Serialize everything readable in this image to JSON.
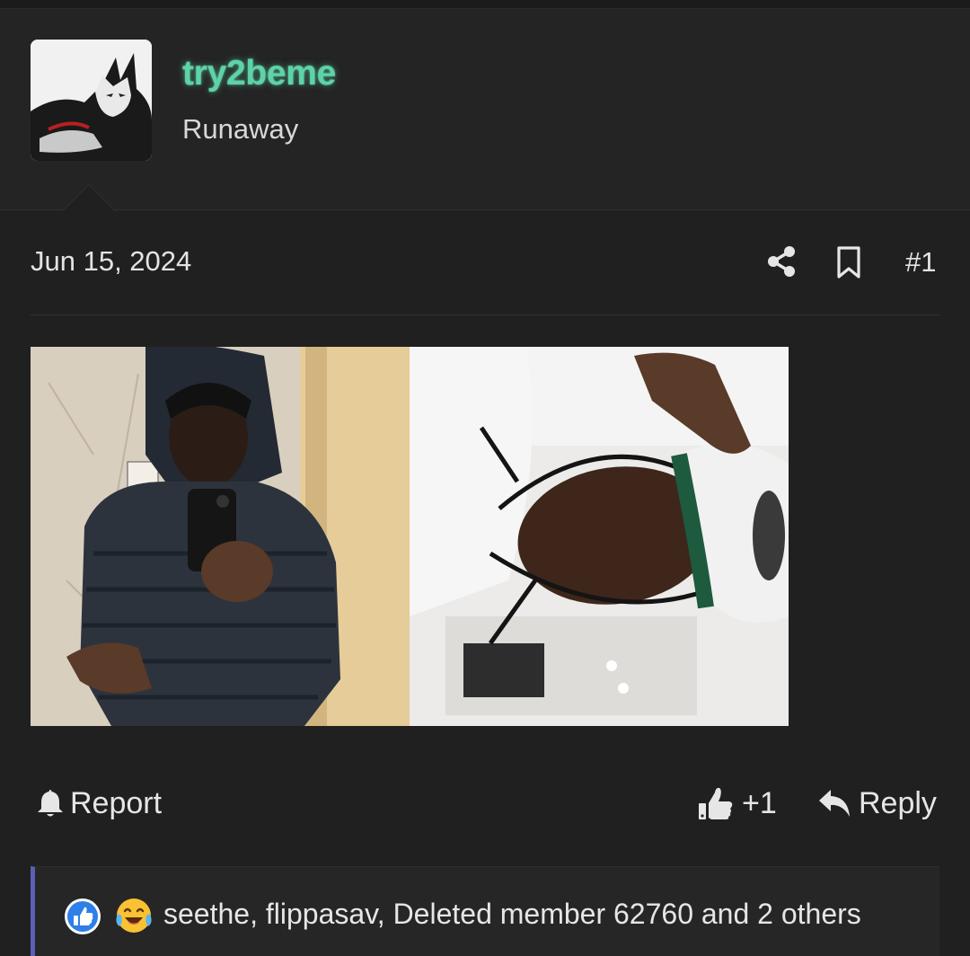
{
  "post": {
    "author": {
      "username": "try2beme",
      "title": "Runaway",
      "username_color": "#5ed3a8"
    },
    "date": "Jun 15, 2024",
    "number": "#1",
    "icons": {
      "share": "share-icon",
      "bookmark": "bookmark-icon"
    }
  },
  "footer": {
    "report_label": "Report",
    "reaction_count": "+1",
    "reply_label": "Reply"
  },
  "reactions": {
    "summary": "seethe, flippasav, Deleted member 62760 and 2 others",
    "types": [
      "like",
      "laugh-cry"
    ],
    "accent_color": "#5a5fb8"
  }
}
